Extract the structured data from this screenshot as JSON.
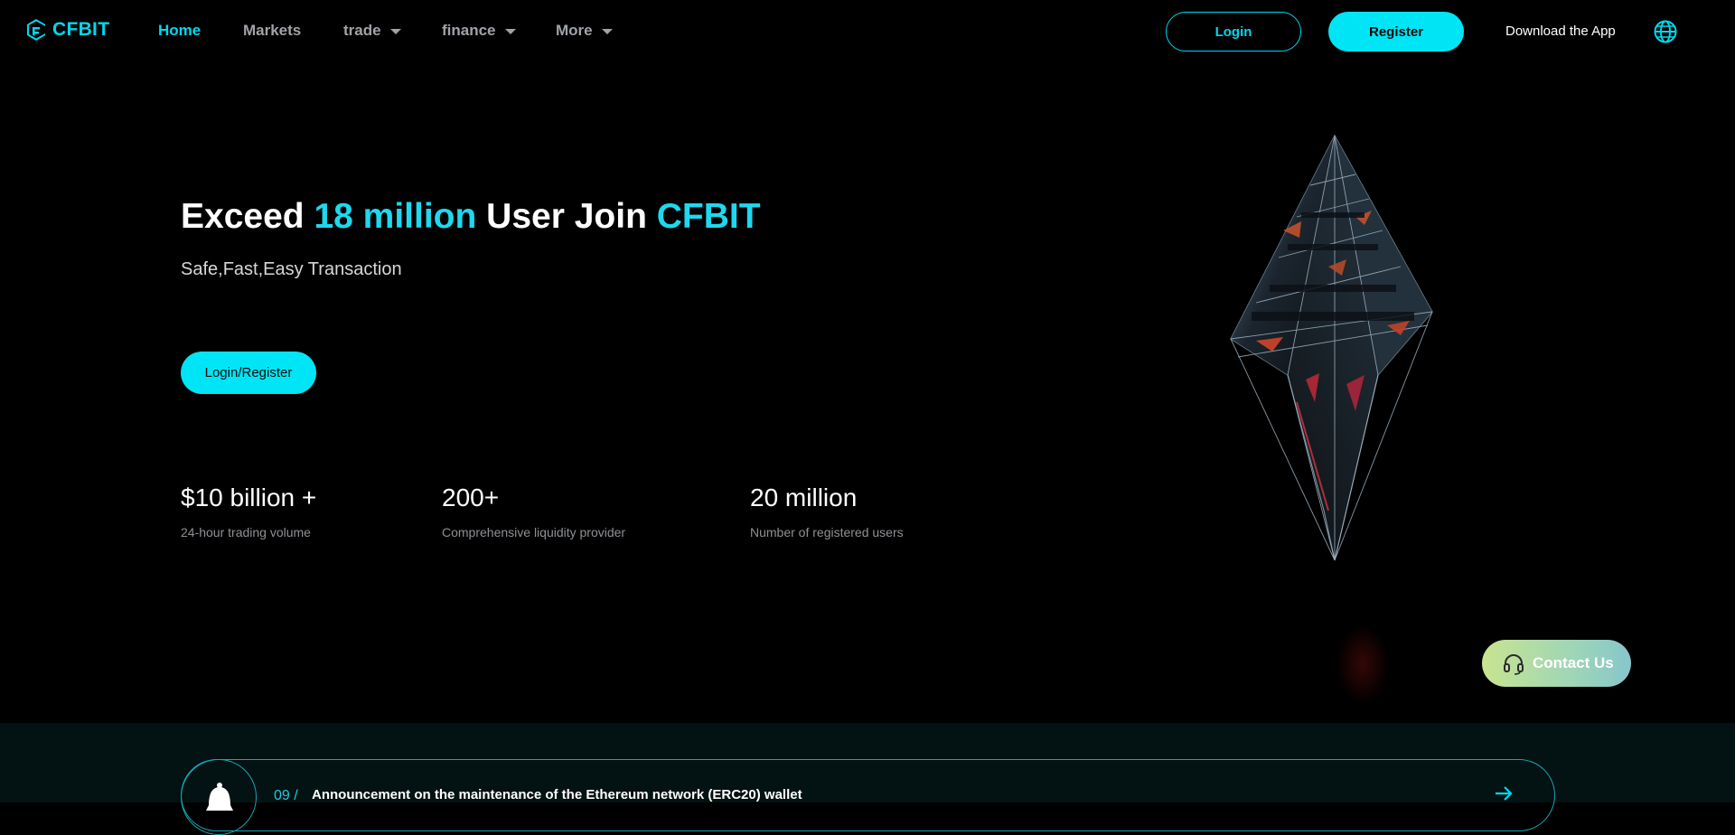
{
  "brand": {
    "name": "CFBIT",
    "accent": "#00d8ee"
  },
  "nav": {
    "items": [
      {
        "label": "Home",
        "active": true,
        "dropdown": false
      },
      {
        "label": "Markets",
        "active": false,
        "dropdown": false
      },
      {
        "label": "trade",
        "active": false,
        "dropdown": true
      },
      {
        "label": "finance",
        "active": false,
        "dropdown": true
      },
      {
        "label": "More",
        "active": false,
        "dropdown": true
      }
    ],
    "login_label": "Login",
    "register_label": "Register",
    "download_label": "Download the App",
    "language_icon": "globe-icon"
  },
  "hero": {
    "title_part1": "Exceed ",
    "title_highlight1": "18 million",
    "title_part2": " User Join ",
    "title_highlight2": "CFBIT",
    "subtitle": "Safe,Fast,Easy Transaction",
    "cta_label": "Login/Register",
    "stats": [
      {
        "value": "$10 billion +",
        "label": "24-hour trading volume"
      },
      {
        "value": "200+",
        "label": "Comprehensive liquidity provider"
      },
      {
        "value": "20 million",
        "label": "Number of registered users"
      }
    ]
  },
  "contact": {
    "label": "Contact Us",
    "icon": "headset-icon"
  },
  "announcement": {
    "number": "09 /",
    "text": "Announcement on the maintenance of the Ethereum network (ERC20) wallet",
    "icon": "bell-icon",
    "arrow_icon": "arrow-right-icon"
  }
}
